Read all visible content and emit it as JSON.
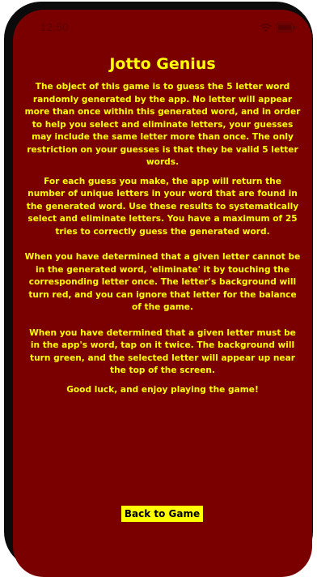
{
  "status_bar": {
    "time": "12:50",
    "wifi_icon": "wifi-icon",
    "battery_icon": "battery-icon"
  },
  "title": "Jotto Genius",
  "paragraphs": [
    "The object of this game is to guess the 5 letter word randomly generated by the app.  No letter will appear more than once within this generated word, and in order to help you select and eliminate letters, your guesses may include the same letter more than once. The only restriction on your guesses is that they be valid 5 letter words.",
    "For each guess you make, the app will return the number of unique letters in your word that are found in the generated word.  Use these results to systematically select and eliminate letters.  You have a maximum of 25 tries to correctly guess the generated word.",
    "When you have determined that a given letter cannot be in the generated word, 'eliminate' it by touching the corresponding letter once.  The letter's background will turn red, and you can ignore that letter for the balance of the game.",
    "When you have determined that a given letter must be in the app's word, tap on it twice.  The background will turn green, and the selected letter will appear up near the top of the screen.",
    "Good luck, and enjoy playing the game!"
  ],
  "back_button_label": "Back to Game",
  "colors": {
    "background": "#7a0000",
    "text": "#ffff00",
    "button_bg": "#ffff00",
    "button_text": "#000000"
  }
}
